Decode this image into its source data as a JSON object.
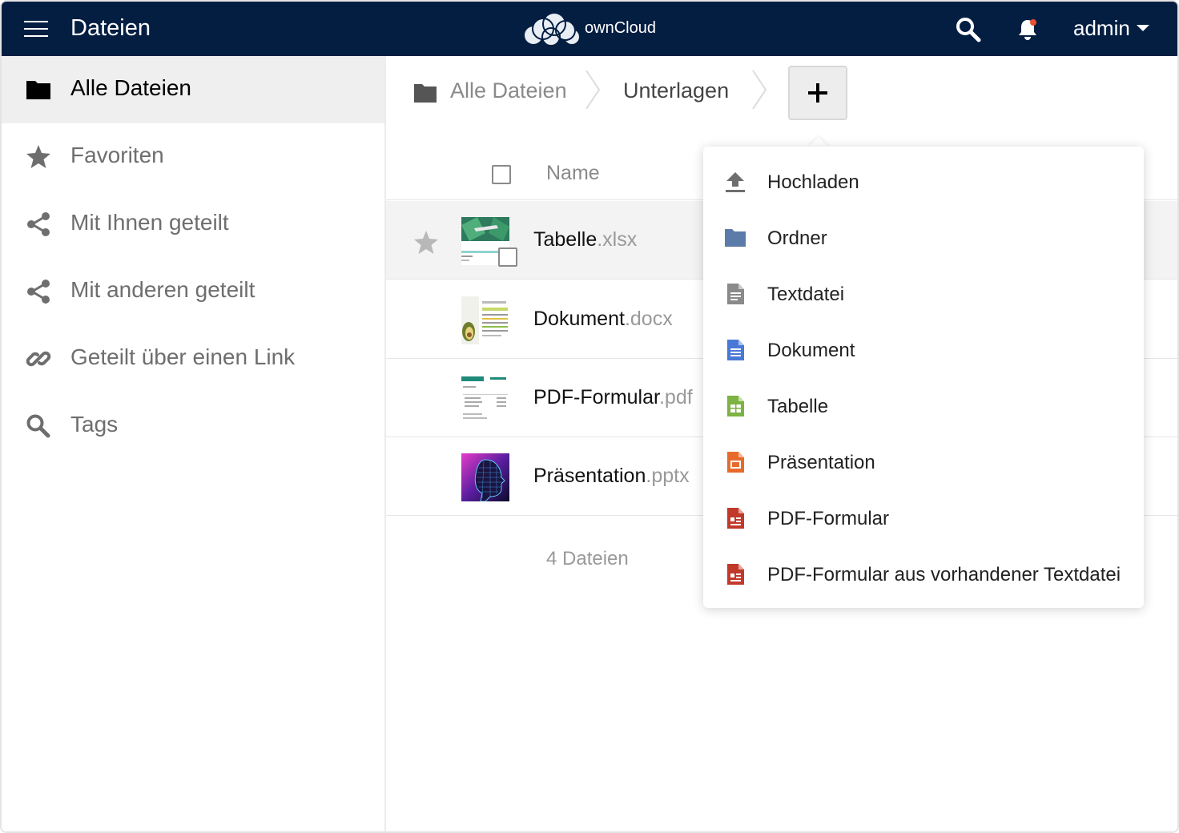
{
  "header": {
    "app_title": "Dateien",
    "logo_text": "ownCloud",
    "user": "admin",
    "bg_color": "#041e42"
  },
  "sidebar": {
    "items": [
      {
        "label": "Alle Dateien",
        "icon": "folder-icon",
        "active": true
      },
      {
        "label": "Favoriten",
        "icon": "star-icon"
      },
      {
        "label": "Mit Ihnen geteilt",
        "icon": "share-icon"
      },
      {
        "label": "Mit anderen geteilt",
        "icon": "share-icon"
      },
      {
        "label": "Geteilt über einen Link",
        "icon": "link-icon"
      },
      {
        "label": "Tags",
        "icon": "search-icon"
      }
    ]
  },
  "breadcrumb": {
    "items": [
      "Alle Dateien",
      "Unterlagen"
    ]
  },
  "file_list": {
    "column_name": "Name",
    "files": [
      {
        "name": "Tabelle",
        "ext": ".xlsx",
        "thumb": "spreadsheet-thumbnail"
      },
      {
        "name": "Dokument",
        "ext": ".docx",
        "thumb": "document-thumbnail"
      },
      {
        "name": "PDF-Formular",
        "ext": ".pdf",
        "thumb": "invoice-thumbnail"
      },
      {
        "name": "Präsentation",
        "ext": ".pptx",
        "thumb": "presentation-thumbnail"
      }
    ],
    "summary": "4 Dateien"
  },
  "new_menu": {
    "items": [
      {
        "label": "Hochladen",
        "icon": "upload-icon",
        "color": "#6e6e6e"
      },
      {
        "label": "Ordner",
        "icon": "folder-icon",
        "color": "#5b7ba8"
      },
      {
        "label": "Textdatei",
        "icon": "text-file-icon",
        "color": "#8a8a8a"
      },
      {
        "label": "Dokument",
        "icon": "document-icon",
        "color": "#4a78d6"
      },
      {
        "label": "Tabelle",
        "icon": "spreadsheet-icon",
        "color": "#7cb342"
      },
      {
        "label": "Präsentation",
        "icon": "presentation-icon",
        "color": "#e8692c"
      },
      {
        "label": "PDF-Formular",
        "icon": "pdf-form-icon",
        "color": "#c0392b"
      },
      {
        "label": "PDF-Formular aus vorhandener Textdatei",
        "icon": "pdf-form-icon",
        "color": "#c0392b"
      }
    ]
  }
}
